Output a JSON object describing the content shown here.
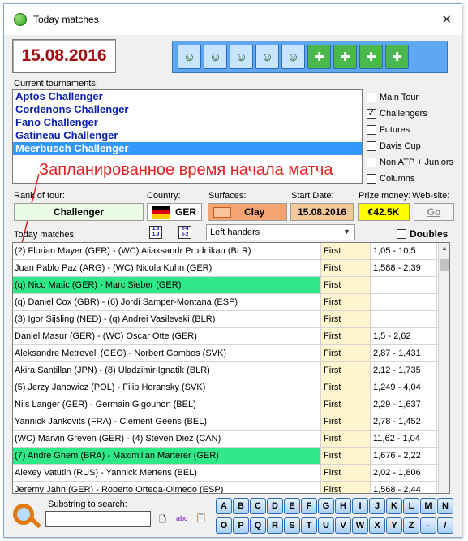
{
  "window": {
    "title": "Today matches",
    "close_glyph": "✕"
  },
  "date": "15.08.2016",
  "toolbar_icons": [
    "player-1-icon",
    "player-2-icon",
    "doubles-icon",
    "racket-icon",
    "players-group-icon",
    "add-q-icon",
    "players-q-icon",
    "export-m-icon",
    "export-p-icon"
  ],
  "labels": {
    "current_tournaments": "Current tournaments:",
    "rank_of_tour": "Rank of tour:",
    "country": "Country:",
    "surfaces": "Surfaces:",
    "start_date": "Start Date:",
    "prize_money": "Prize money:",
    "website": "Web-site:",
    "today_matches": "Today matches:",
    "substring_to_search": "Substring to search:"
  },
  "tournaments": [
    "Aptos Challenger",
    "Cordenons Challenger",
    "Fano Challenger",
    "Gatineau Challenger",
    "Meerbusch Challenger"
  ],
  "selected_tournament_index": 4,
  "filters": [
    {
      "label": "Main Tour",
      "checked": false
    },
    {
      "label": "Challengers",
      "checked": true
    },
    {
      "label": "Futures",
      "checked": false
    },
    {
      "label": "Davis Cup",
      "checked": false
    },
    {
      "label": "Non ATP + Juniors",
      "checked": false
    },
    {
      "label": "Columns",
      "checked": false
    }
  ],
  "annotation_text": "Запланированное время начала матча",
  "tour_info": {
    "rank": "Challenger",
    "country": "GER",
    "surface": "Clay",
    "start_date": "15.08.2016",
    "prize_money": "€42.5K",
    "website_button": "Go"
  },
  "colors": {
    "date_text": "#a30e16",
    "surface_bg": "#f4a470",
    "prize_bg": "#ffff00",
    "highlight_row": "#2fe988",
    "annotation": "#e52222"
  },
  "handedness_select": "Left handers",
  "doubles_label": "Doubles",
  "matches": [
    {
      "players": "(2) Florian Mayer (GER) - (WC) Aliaksandr Prudnikau (BLR)",
      "time": "First",
      "odds": "1,05 - 10,5",
      "highlight": false
    },
    {
      "players": "Juan Pablo Paz (ARG) - (WC) Nicola Kuhn (GER)",
      "time": "First",
      "odds": "1,588 - 2,39",
      "highlight": false
    },
    {
      "players": "(q) Nico Matic (GER) - Marc Sieber (GER)",
      "time": "First",
      "odds": "",
      "highlight": true
    },
    {
      "players": "(q) Daniel Cox (GBR) - (6) Jordi Samper-Montana (ESP)",
      "time": "First",
      "odds": "",
      "highlight": false
    },
    {
      "players": "(3) Igor Sijsling (NED) - (q) Andrei Vasilevski (BLR)",
      "time": "First",
      "odds": "",
      "highlight": false
    },
    {
      "players": "Daniel Masur (GER) - (WC) Oscar Otte (GER)",
      "time": "First",
      "odds": "1,5 - 2,62",
      "highlight": false
    },
    {
      "players": "Aleksandre Metreveli (GEO) - Norbert Gombos (SVK)",
      "time": "First",
      "odds": "2,87 - 1,431",
      "highlight": false
    },
    {
      "players": "Akira Santillan (JPN) - (8) Uladzimir Ignatik (BLR)",
      "time": "First",
      "odds": "2,12 - 1,735",
      "highlight": false
    },
    {
      "players": "(5) Jerzy Janowicz (POL) - Filip Horansky (SVK)",
      "time": "First",
      "odds": "1,249 - 4,04",
      "highlight": false
    },
    {
      "players": "Nils Langer (GER) - Germain Gigounon (BEL)",
      "time": "First",
      "odds": "2,29 - 1,637",
      "highlight": false
    },
    {
      "players": "Yannick Jankovits (FRA) - Clement Geens (BEL)",
      "time": "First",
      "odds": "2,78 - 1,452",
      "highlight": false
    },
    {
      "players": "(WC) Marvin Greven (GER) - (4) Steven Diez (CAN)",
      "time": "First",
      "odds": "11,62 - 1,04",
      "highlight": false
    },
    {
      "players": "(7) Andre Ghem (BRA) - Maximilian Marterer (GER)",
      "time": "First",
      "odds": "1,676 - 2,22",
      "highlight": true
    },
    {
      "players": "Alexey Vatutin (RUS) - Yannick Mertens (BEL)",
      "time": "First",
      "odds": "2,02 - 1,806",
      "highlight": false
    },
    {
      "players": "Jeremy Jahn (GER) - Roberto Ortega-Olmedo (ESP)",
      "time": "First",
      "odds": "1,568 - 2,44",
      "highlight": false
    }
  ],
  "search": {
    "value": ""
  },
  "alphabet": [
    "A",
    "B",
    "C",
    "D",
    "E",
    "F",
    "G",
    "H",
    "I",
    "J",
    "K",
    "L",
    "M",
    "N",
    "O",
    "P",
    "Q",
    "R",
    "S",
    "T",
    "U",
    "V",
    "W",
    "X",
    "Y",
    "Z",
    "-",
    "/"
  ]
}
